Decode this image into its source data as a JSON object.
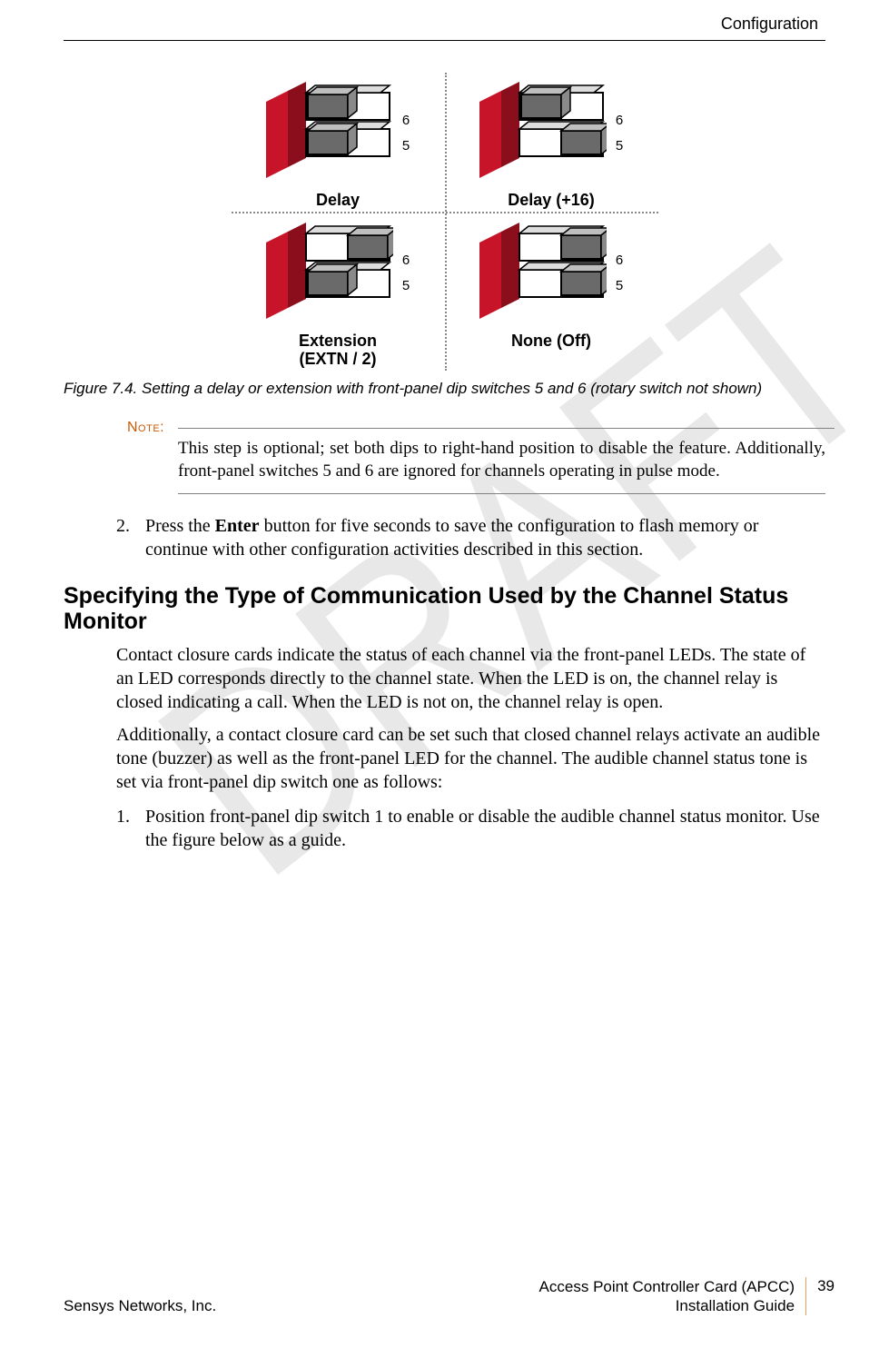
{
  "header": {
    "section": "Configuration"
  },
  "watermark": "DRAFT",
  "figure": {
    "cells": [
      {
        "label": "Delay",
        "sw6": "left",
        "sw5": "left"
      },
      {
        "label": "Delay (+16)",
        "sw6": "left",
        "sw5": "right"
      },
      {
        "label": "Extension\n(EXTN / 2)",
        "sw6": "right",
        "sw5": "left"
      },
      {
        "label": "None (Off)",
        "sw6": "right",
        "sw5": "right"
      }
    ],
    "row_labels": {
      "top": "6",
      "bottom": "5"
    },
    "caption": "Figure 7.4. Setting a delay or extension with front-panel dip switches 5 and 6 (rotary switch not shown)"
  },
  "note": {
    "label": "Note:",
    "body": "This step is optional; set both dips to right-hand position to disable the feature. Additionally, front-panel switches 5 and 6 are ignored for channels operating in pulse mode."
  },
  "step2": {
    "num": "2.",
    "pre": "Press the ",
    "bold": "Enter",
    "post": " button for five seconds to save the configuration to flash memory or continue with other configuration activities described in this section."
  },
  "section_heading": "Specifying the Type of Communication Used by the Channel Status Monitor",
  "para1": "Contact closure cards indicate the status of each channel via the front-panel LEDs. The state of an LED corresponds directly to the channel state. When the LED is on, the channel relay is closed indicating a call. When the LED is not on, the channel relay is open.",
  "para2": "Additionally, a contact closure card can be set such that closed channel relays activate an audible tone (buzzer) as well as the front-panel LED for the channel. The audible channel status tone is set via front-panel dip switch one as follows:",
  "step1b": {
    "num": "1.",
    "text": "Position front-panel dip switch 1 to enable or disable the audible channel status monitor. Use the figure below as a guide."
  },
  "footer": {
    "left": "Sensys Networks, Inc.",
    "right1": "Access Point Controller Card (APCC)",
    "right2": "Installation Guide",
    "page": "39"
  }
}
